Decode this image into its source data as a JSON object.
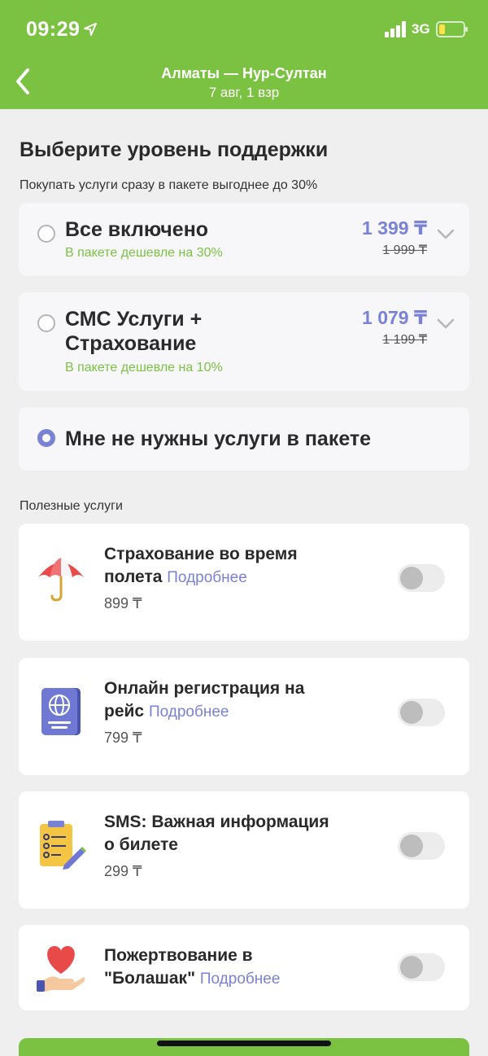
{
  "status_bar": {
    "time": "09:29",
    "network": "3G"
  },
  "header": {
    "route": "Алматы — Нур-Султан",
    "details": "7 авг, 1 взр"
  },
  "page": {
    "title": "Выберите уровень поддержки",
    "subtitle": "Покупать услуги сразу в пакете выгоднее до 30%"
  },
  "packages": [
    {
      "title": "Все включено",
      "note": "В пакете дешевле на 30%",
      "price": "1 399 ₸",
      "old_price": "1 999 ₸",
      "selected": false
    },
    {
      "title_line1": "СМС Услуги +",
      "title_line2": "Страхование",
      "note": "В пакете дешевле на 10%",
      "price": "1 079 ₸",
      "old_price": "1 199 ₸",
      "selected": false
    },
    {
      "title": "Мне не нужны услуги в пакете",
      "selected": true
    }
  ],
  "services_label": "Полезные услуги",
  "services": [
    {
      "title_line1": "Страхование во время",
      "title_line2": "полета",
      "link": "Подробнее",
      "price": "899 ₸",
      "icon": "umbrella-icon",
      "enabled": false
    },
    {
      "title_line1": "Онлайн регистрация на",
      "title_line2": "рейс",
      "link": "Подробнее",
      "price": "799 ₸",
      "icon": "passport-icon",
      "enabled": false
    },
    {
      "title_line1": "SMS: Важная информация",
      "title_line2": "о билете",
      "price": "299 ₸",
      "icon": "checklist-icon",
      "enabled": false
    },
    {
      "title_line1": "Пожертвование в",
      "title_line2": "\"Болашак\"",
      "link": "Подробнее",
      "icon": "heart-hand-icon",
      "enabled": false
    }
  ],
  "colors": {
    "brand_green": "#7cc242",
    "accent_purple": "#7a82d6"
  }
}
